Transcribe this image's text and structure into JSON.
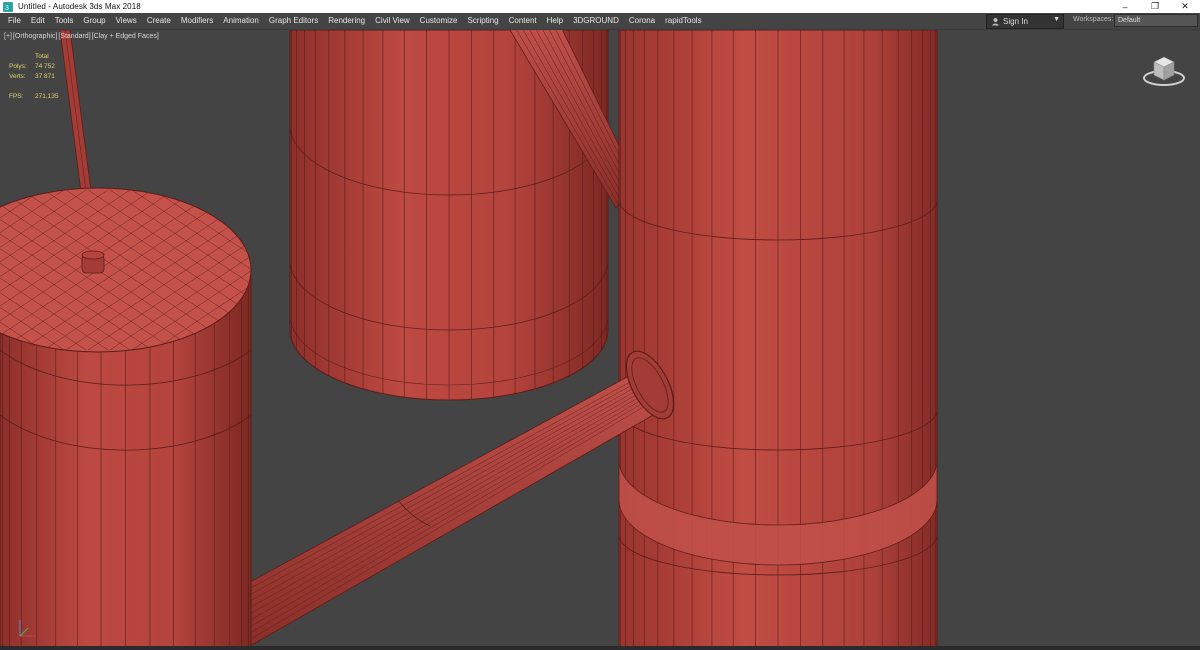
{
  "window": {
    "title": "Untitled - Autodesk 3ds Max 2018",
    "controls": [
      "minimize",
      "restore",
      "close"
    ]
  },
  "menubar": {
    "items": [
      "File",
      "Edit",
      "Tools",
      "Group",
      "Views",
      "Create",
      "Modifiers",
      "Animation",
      "Graph Editors",
      "Rendering",
      "Civil View",
      "Customize",
      "Scripting",
      "Content",
      "Help",
      "3DGROUND",
      "Corona",
      "rapidTools"
    ]
  },
  "account": {
    "sign_in": "Sign In"
  },
  "workspaces": {
    "label": "Workspaces:",
    "value": "Default"
  },
  "viewport": {
    "labels": [
      "[+]",
      "[Orthographic]",
      "[Standard]",
      "[Clay + Edged Faces]"
    ],
    "stats": {
      "total_label": "Total",
      "polys_label": "Polys:",
      "polys_value": "74 752",
      "verts_label": "Verts:",
      "verts_value": "37 871",
      "fps_label": "FPS:",
      "fps_value": "271,135"
    }
  },
  "colors": {
    "viewport_bg": "#444444",
    "object_fill": "#b3453e",
    "stats_text": "#e4d46a"
  },
  "icons": [
    "3dsmax-app-icon",
    "user-icon",
    "chevron-down-icon",
    "viewcube-icon",
    "axis-tripod-icon"
  ]
}
